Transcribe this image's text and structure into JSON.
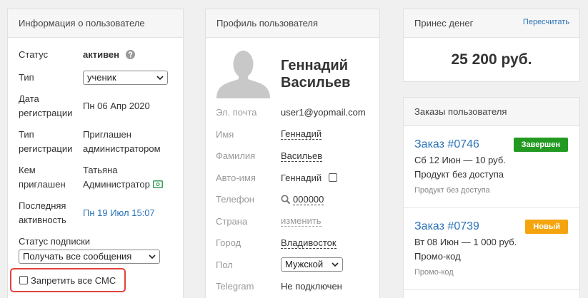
{
  "user_info": {
    "title": "Информация о пользователе",
    "status": {
      "label": "Статус",
      "value": "активен"
    },
    "type": {
      "label": "Тип",
      "value": "ученик"
    },
    "registration_date": {
      "label": "Дата регистрации",
      "value": "Пн 06 Апр 2020"
    },
    "registration_type": {
      "label": "Тип регистрации",
      "value": "Приглашен администратором"
    },
    "invited_by": {
      "label": "Кем приглашен",
      "value": "Татьяна Администратор"
    },
    "last_activity": {
      "label": "Последняя активность",
      "value": "Пн 19 Июл 15:07"
    },
    "subscription": {
      "label": "Статус подписки",
      "value": "Получать все сообщения"
    },
    "block_sms": {
      "label": "Запретить все СМС",
      "checked": false,
      "highlighted": true
    }
  },
  "profile": {
    "title": "Профиль пользователя",
    "full_name": "Геннадий Васильев",
    "email": {
      "label": "Эл. почта",
      "value": "user1@yopmail.com"
    },
    "first_name": {
      "label": "Имя",
      "value": "Геннадий"
    },
    "last_name": {
      "label": "Фамилия",
      "value": "Васильев"
    },
    "auto_name": {
      "label": "Авто-имя",
      "value": "Геннадий",
      "checked": false
    },
    "phone": {
      "label": "Телефон",
      "value": "000000"
    },
    "country": {
      "label": "Страна",
      "value": "изменить"
    },
    "city": {
      "label": "Город",
      "value": "Владивосток"
    },
    "gender": {
      "label": "Пол",
      "value": "Мужской"
    },
    "telegram": {
      "label": "Telegram",
      "value": "Не подключен"
    }
  },
  "revenue": {
    "title": "Принес денег",
    "recalculate_label": "Пересчитать",
    "amount": "25 200 руб."
  },
  "orders": {
    "title": "Заказы пользователя",
    "items": [
      {
        "number": "Заказ #0746",
        "status": "Завершен",
        "status_color": "#229a22",
        "summary": "Сб 12 Июн — 10 руб.",
        "product": "Продукт без доступа",
        "note": "Продукт без доступа"
      },
      {
        "number": "Заказ #0739",
        "status": "Новый",
        "status_color": "#f4a50d",
        "summary": "Вт 08 Июн — 1 000 руб.",
        "product": "Промо-код",
        "note": "Промо-код"
      }
    ]
  },
  "colors": {
    "link": "#2b73b7",
    "muted_label": "#9a9a9a",
    "highlight_border": "#e0433d",
    "panel_header": "#f6f6f6",
    "page_background": "#f0f0f0"
  },
  "icons": {
    "status_help": "help-icon",
    "inviter_card": "card-icon",
    "phone_search": "search-icon",
    "select_arrow": "chevron-down-icon",
    "avatar": "user-silhouette-icon"
  }
}
